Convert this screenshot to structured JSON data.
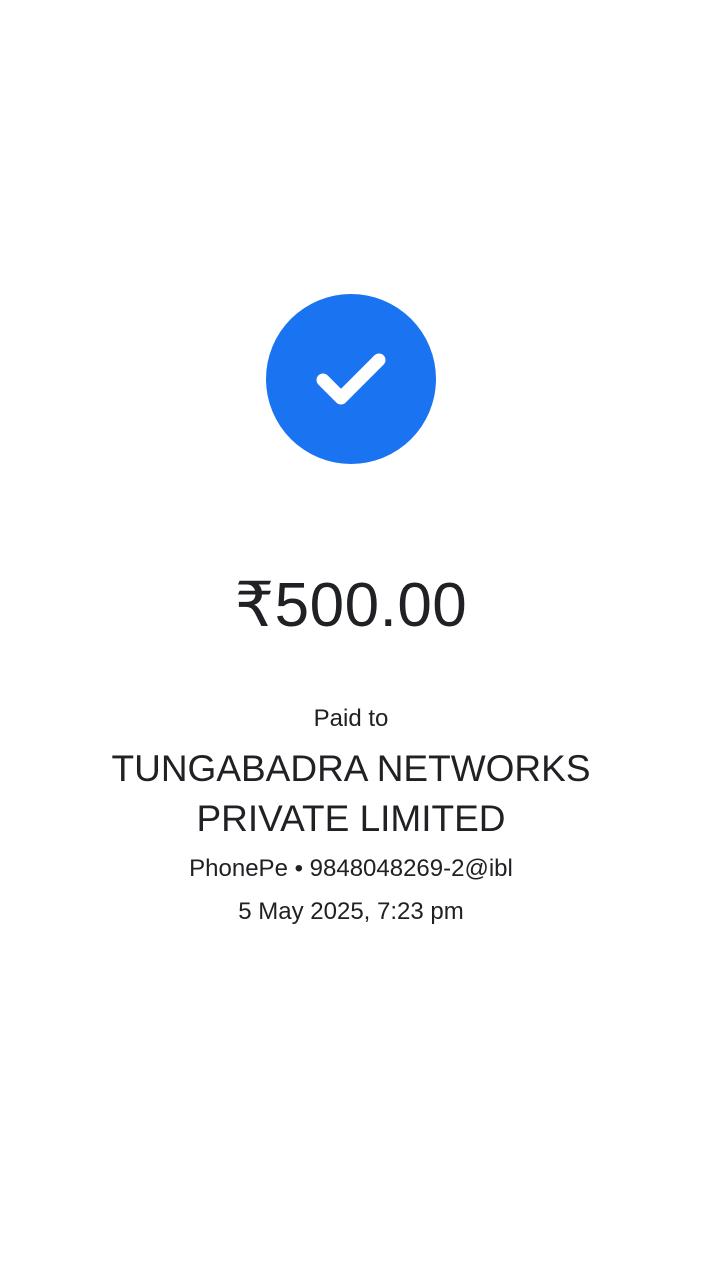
{
  "status": {
    "icon": "check-icon",
    "accent_color": "#1a73f0"
  },
  "payment": {
    "amount": "₹500.00",
    "paid_to_label": "Paid to",
    "payee_name": "TUNGABADRA NETWORKS PRIVATE LIMITED",
    "payee_upi": "PhonePe • 9848048269-2@ibl",
    "datetime": "5 May 2025, 7:23 pm"
  }
}
